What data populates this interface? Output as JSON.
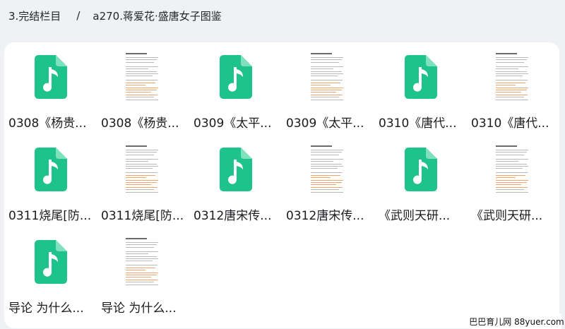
{
  "breadcrumb": {
    "parent": "3.完结栏目",
    "separator": "/",
    "current": "a270.蒋爱花·盛唐女子图鉴"
  },
  "colors": {
    "audio_icon": "#1ec28b",
    "accent_lines": "#f2a36b"
  },
  "files": [
    {
      "name": "0308《杨贵...",
      "type": "audio",
      "icon": "music-file-icon"
    },
    {
      "name": "0308《杨贵...",
      "type": "document",
      "icon": "document-thumbnail"
    },
    {
      "name": "0309《太平...",
      "type": "audio",
      "icon": "music-file-icon"
    },
    {
      "name": "0309《太平...",
      "type": "document",
      "icon": "document-thumbnail"
    },
    {
      "name": "0310《唐代...",
      "type": "audio",
      "icon": "music-file-icon"
    },
    {
      "name": "0310《唐代...",
      "type": "document",
      "icon": "document-thumbnail"
    },
    {
      "name": "0311烧尾[防...",
      "type": "audio",
      "icon": "music-file-icon"
    },
    {
      "name": "0311烧尾[防...",
      "type": "document",
      "icon": "document-thumbnail"
    },
    {
      "name": "0312唐宋传...",
      "type": "audio",
      "icon": "music-file-icon"
    },
    {
      "name": "0312唐宋传...",
      "type": "document",
      "icon": "document-thumbnail"
    },
    {
      "name": "《武则天研...",
      "type": "audio",
      "icon": "music-file-icon"
    },
    {
      "name": "《武则天研...",
      "type": "document",
      "icon": "document-thumbnail"
    },
    {
      "name": "导论 为什么...",
      "type": "audio",
      "icon": "music-file-icon"
    },
    {
      "name": "导论 为什么...",
      "type": "document",
      "icon": "document-thumbnail"
    }
  ],
  "watermark": "巴巴育儿网 88yuer.com"
}
